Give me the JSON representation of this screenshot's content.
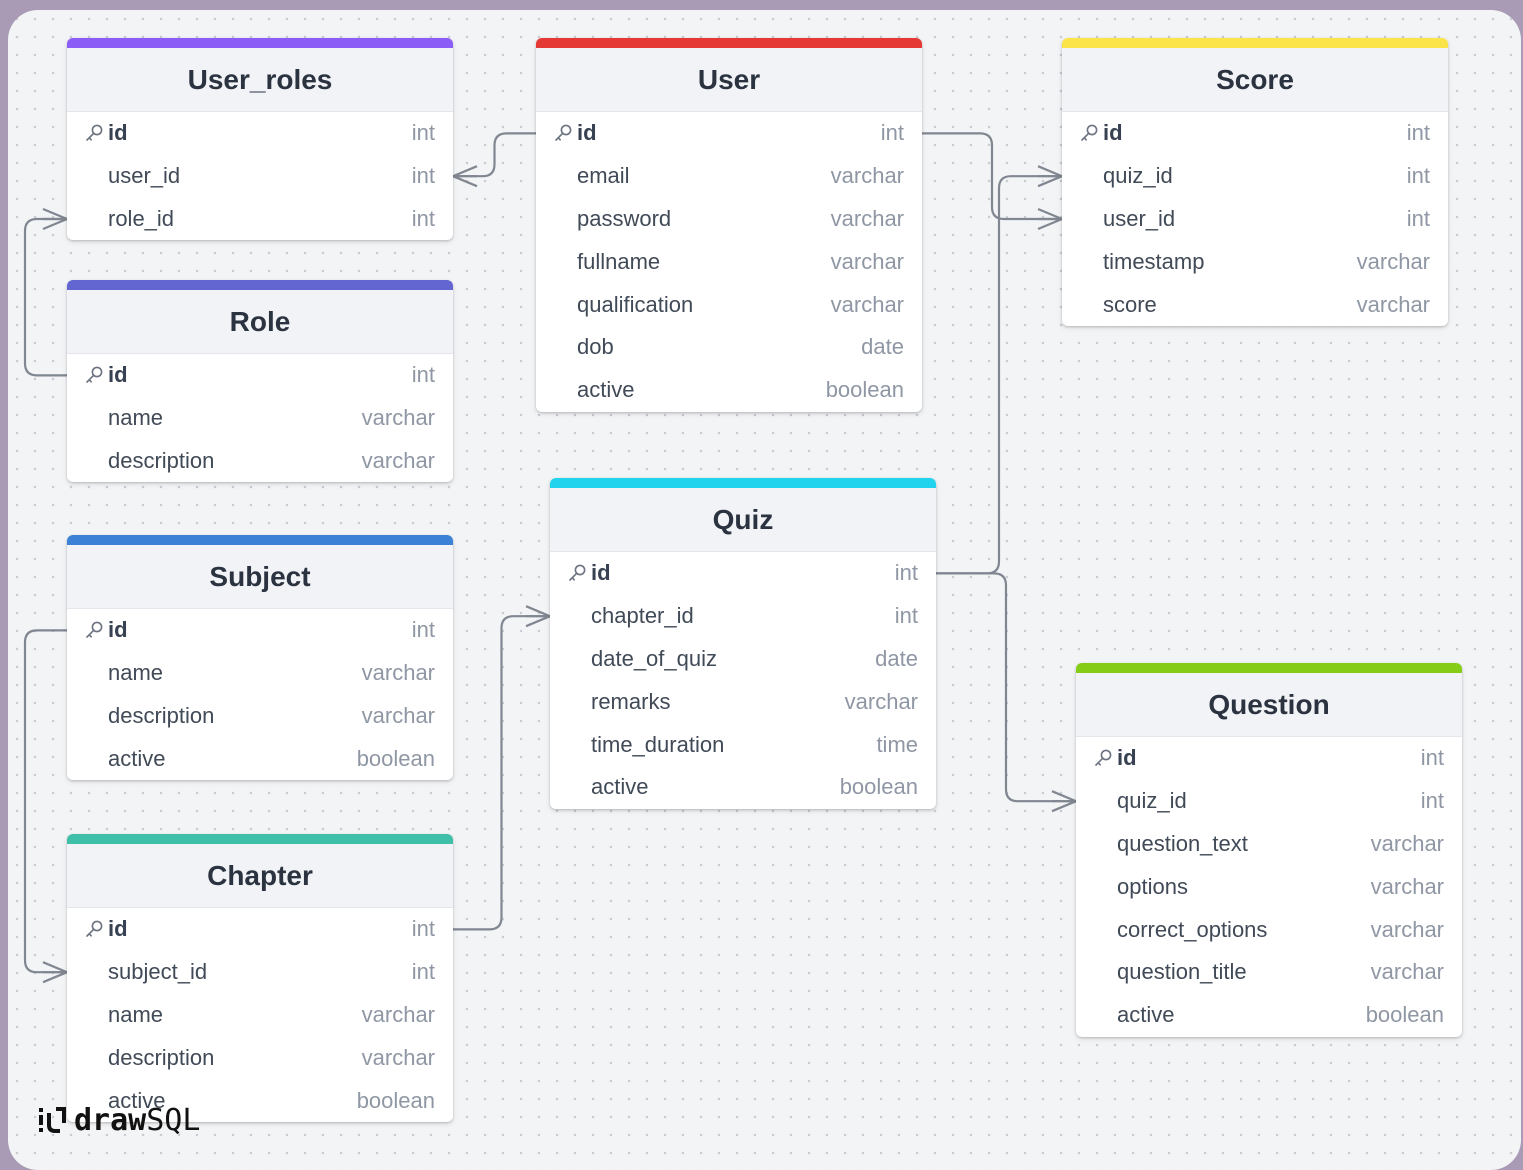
{
  "tables": [
    {
      "title": "User_roles",
      "color": "#8b5cf6",
      "fields": [
        {
          "name": "id",
          "type": "int",
          "pk": true
        },
        {
          "name": "user_id",
          "type": "int"
        },
        {
          "name": "role_id",
          "type": "int"
        }
      ]
    },
    {
      "title": "User",
      "color": "#e53935",
      "fields": [
        {
          "name": "id",
          "type": "int",
          "pk": true
        },
        {
          "name": "email",
          "type": "varchar"
        },
        {
          "name": "password",
          "type": "varchar"
        },
        {
          "name": "fullname",
          "type": "varchar"
        },
        {
          "name": "qualification",
          "type": "varchar"
        },
        {
          "name": "dob",
          "type": "date"
        },
        {
          "name": "active",
          "type": "boolean"
        }
      ]
    },
    {
      "title": "Score",
      "color": "#fbe34a",
      "fields": [
        {
          "name": "id",
          "type": "int",
          "pk": true
        },
        {
          "name": "quiz_id",
          "type": "int"
        },
        {
          "name": "user_id",
          "type": "int"
        },
        {
          "name": "timestamp",
          "type": "varchar"
        },
        {
          "name": "score",
          "type": "varchar"
        }
      ]
    },
    {
      "title": "Role",
      "color": "#6366d1",
      "fields": [
        {
          "name": "id",
          "type": "int",
          "pk": true
        },
        {
          "name": "name",
          "type": "varchar"
        },
        {
          "name": "description",
          "type": "varchar"
        }
      ]
    },
    {
      "title": "Subject",
      "color": "#3b82d6",
      "fields": [
        {
          "name": "id",
          "type": "int",
          "pk": true
        },
        {
          "name": "name",
          "type": "varchar"
        },
        {
          "name": "description",
          "type": "varchar"
        },
        {
          "name": "active",
          "type": "boolean"
        }
      ]
    },
    {
      "title": "Quiz",
      "color": "#22d3ee",
      "fields": [
        {
          "name": "id",
          "type": "int",
          "pk": true
        },
        {
          "name": "chapter_id",
          "type": "int"
        },
        {
          "name": "date_of_quiz",
          "type": "date"
        },
        {
          "name": "remarks",
          "type": "varchar"
        },
        {
          "name": "time_duration",
          "type": "time"
        },
        {
          "name": "active",
          "type": "boolean"
        }
      ]
    },
    {
      "title": "Chapter",
      "color": "#3fbfa8",
      "fields": [
        {
          "name": "id",
          "type": "int",
          "pk": true
        },
        {
          "name": "subject_id",
          "type": "int"
        },
        {
          "name": "name",
          "type": "varchar"
        },
        {
          "name": "description",
          "type": "varchar"
        },
        {
          "name": "active",
          "type": "boolean"
        }
      ]
    },
    {
      "title": "Question",
      "color": "#84cc16",
      "fields": [
        {
          "name": "id",
          "type": "int",
          "pk": true
        },
        {
          "name": "quiz_id",
          "type": "int"
        },
        {
          "name": "question_text",
          "type": "varchar"
        },
        {
          "name": "options",
          "type": "varchar"
        },
        {
          "name": "correct_options",
          "type": "varchar"
        },
        {
          "name": "question_title",
          "type": "varchar"
        },
        {
          "name": "active",
          "type": "boolean"
        }
      ]
    }
  ],
  "relations": [
    {
      "from": "User.id",
      "to": "User_roles.user_id"
    },
    {
      "from": "Role.id",
      "to": "User_roles.role_id"
    },
    {
      "from": "User.id",
      "to": "Score.user_id"
    },
    {
      "from": "Quiz.id",
      "to": "Score.quiz_id"
    },
    {
      "from": "Quiz.id",
      "to": "Question.quiz_id"
    },
    {
      "from": "Chapter.id",
      "to": "Quiz.chapter_id"
    },
    {
      "from": "Subject.id",
      "to": "Chapter.subject_id"
    }
  ],
  "branding": {
    "logo_bold": "draw",
    "logo_light": "SQL"
  },
  "colors": {
    "edge": "#808791",
    "page_border": "#a99bb6"
  }
}
